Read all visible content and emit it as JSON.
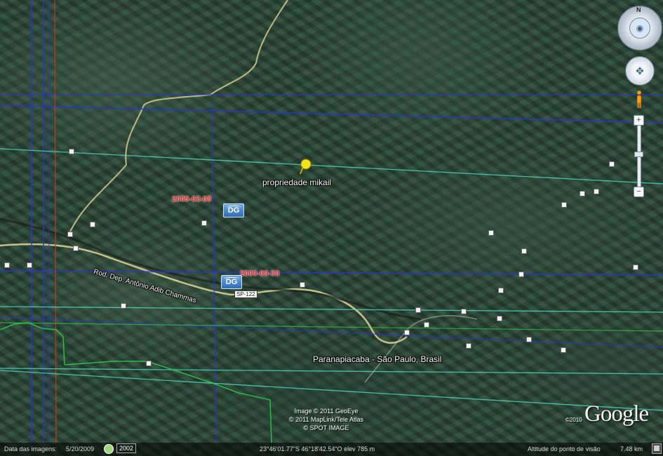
{
  "map": {
    "placemark": {
      "name": "propriedade mikail",
      "icon": "yellow-pushpin-icon"
    },
    "place_label": "Paranapiacaba - São Paulo, Brasil",
    "road_name": "Rod. Dep. Antônio Adib Chammas",
    "road_shield": "SP-122",
    "imagery_overlays": [
      {
        "date": "2009-02-08",
        "badge": "DG"
      },
      {
        "date": "2009-09-30",
        "badge": "DG"
      }
    ],
    "attribution": [
      "Image © 2011 GeoEye",
      "© 2011 MapLink/Tele Atlas",
      "© SPOT IMAGE"
    ],
    "logo": "Google",
    "copyright_year": "©2010",
    "colors": {
      "blue_grid": "#2a36c8",
      "cyan_lines": "#4fe0c8",
      "green_boundary": "#2fd04a",
      "red_line": "#c0392b",
      "road": "#d8cf94"
    }
  },
  "navigation": {
    "compass_label": "N",
    "compass_icon": "look-eye-icon",
    "pan_icon": "pan-arrows-icon",
    "pegman_icon": "street-view-pegman-icon",
    "zoom_in": "+",
    "zoom_out": "−"
  },
  "status_bar": {
    "imagery_date_label": "Data das imagens:",
    "imagery_date": "5/20/2009",
    "history_year": "2002",
    "coordinates": "23°46'01.77\"S   46°18'42.54\"O  elev  785 m",
    "eye_alt_label": "Altitude do ponto de visão",
    "eye_alt": "7.48 km"
  }
}
